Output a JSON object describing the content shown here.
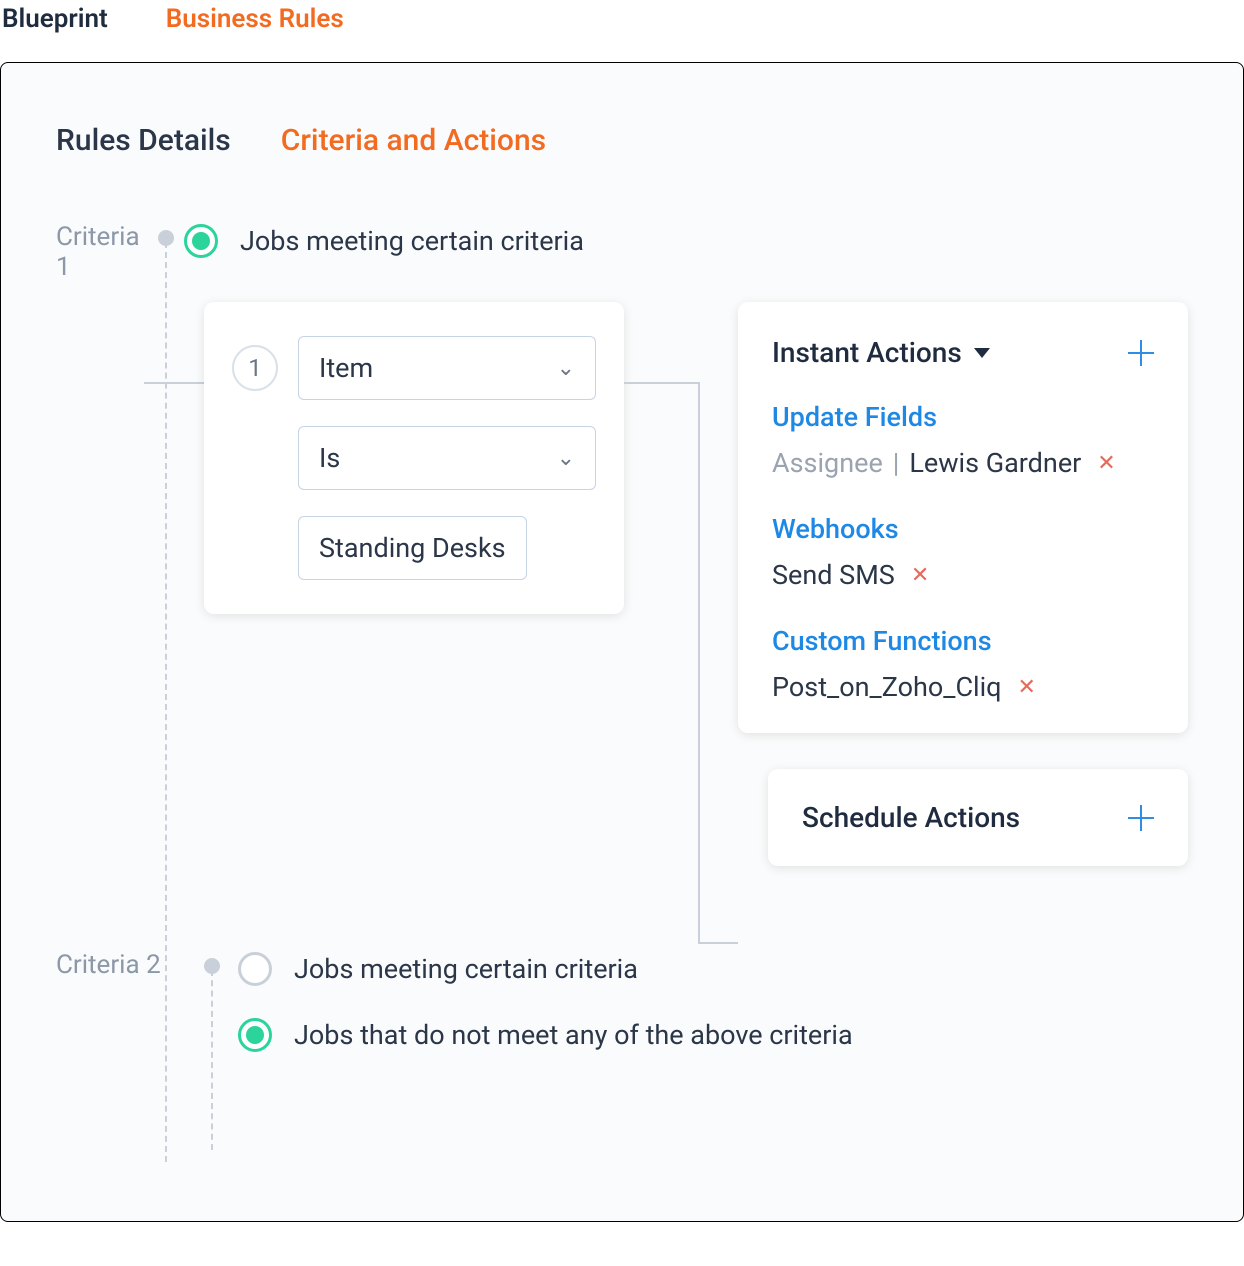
{
  "topTabs": {
    "blueprint": "Blueprint",
    "businessRules": "Business Rules"
  },
  "subTabs": {
    "rulesDetails": "Rules Details",
    "criteriaActions": "Criteria and Actions"
  },
  "criteria1": {
    "label": "Criteria 1",
    "option1": "Jobs meeting certain criteria",
    "condition": {
      "number": "1",
      "field": "Item",
      "operator": "Is",
      "value": "Standing Desks"
    }
  },
  "instantActions": {
    "title": "Instant Actions",
    "updateFields": {
      "title": "Update Fields",
      "fieldLabel": "Assignee",
      "separator": "|",
      "fieldValue": "Lewis Gardner"
    },
    "webhooks": {
      "title": "Webhooks",
      "value": "Send SMS"
    },
    "customFunctions": {
      "title": "Custom Functions",
      "value": "Post_on_Zoho_Cliq"
    }
  },
  "scheduleActions": {
    "title": "Schedule Actions"
  },
  "criteria2": {
    "label": "Criteria 2",
    "option1": "Jobs meeting certain criteria",
    "option2": "Jobs that do not meet any of the above criteria"
  }
}
